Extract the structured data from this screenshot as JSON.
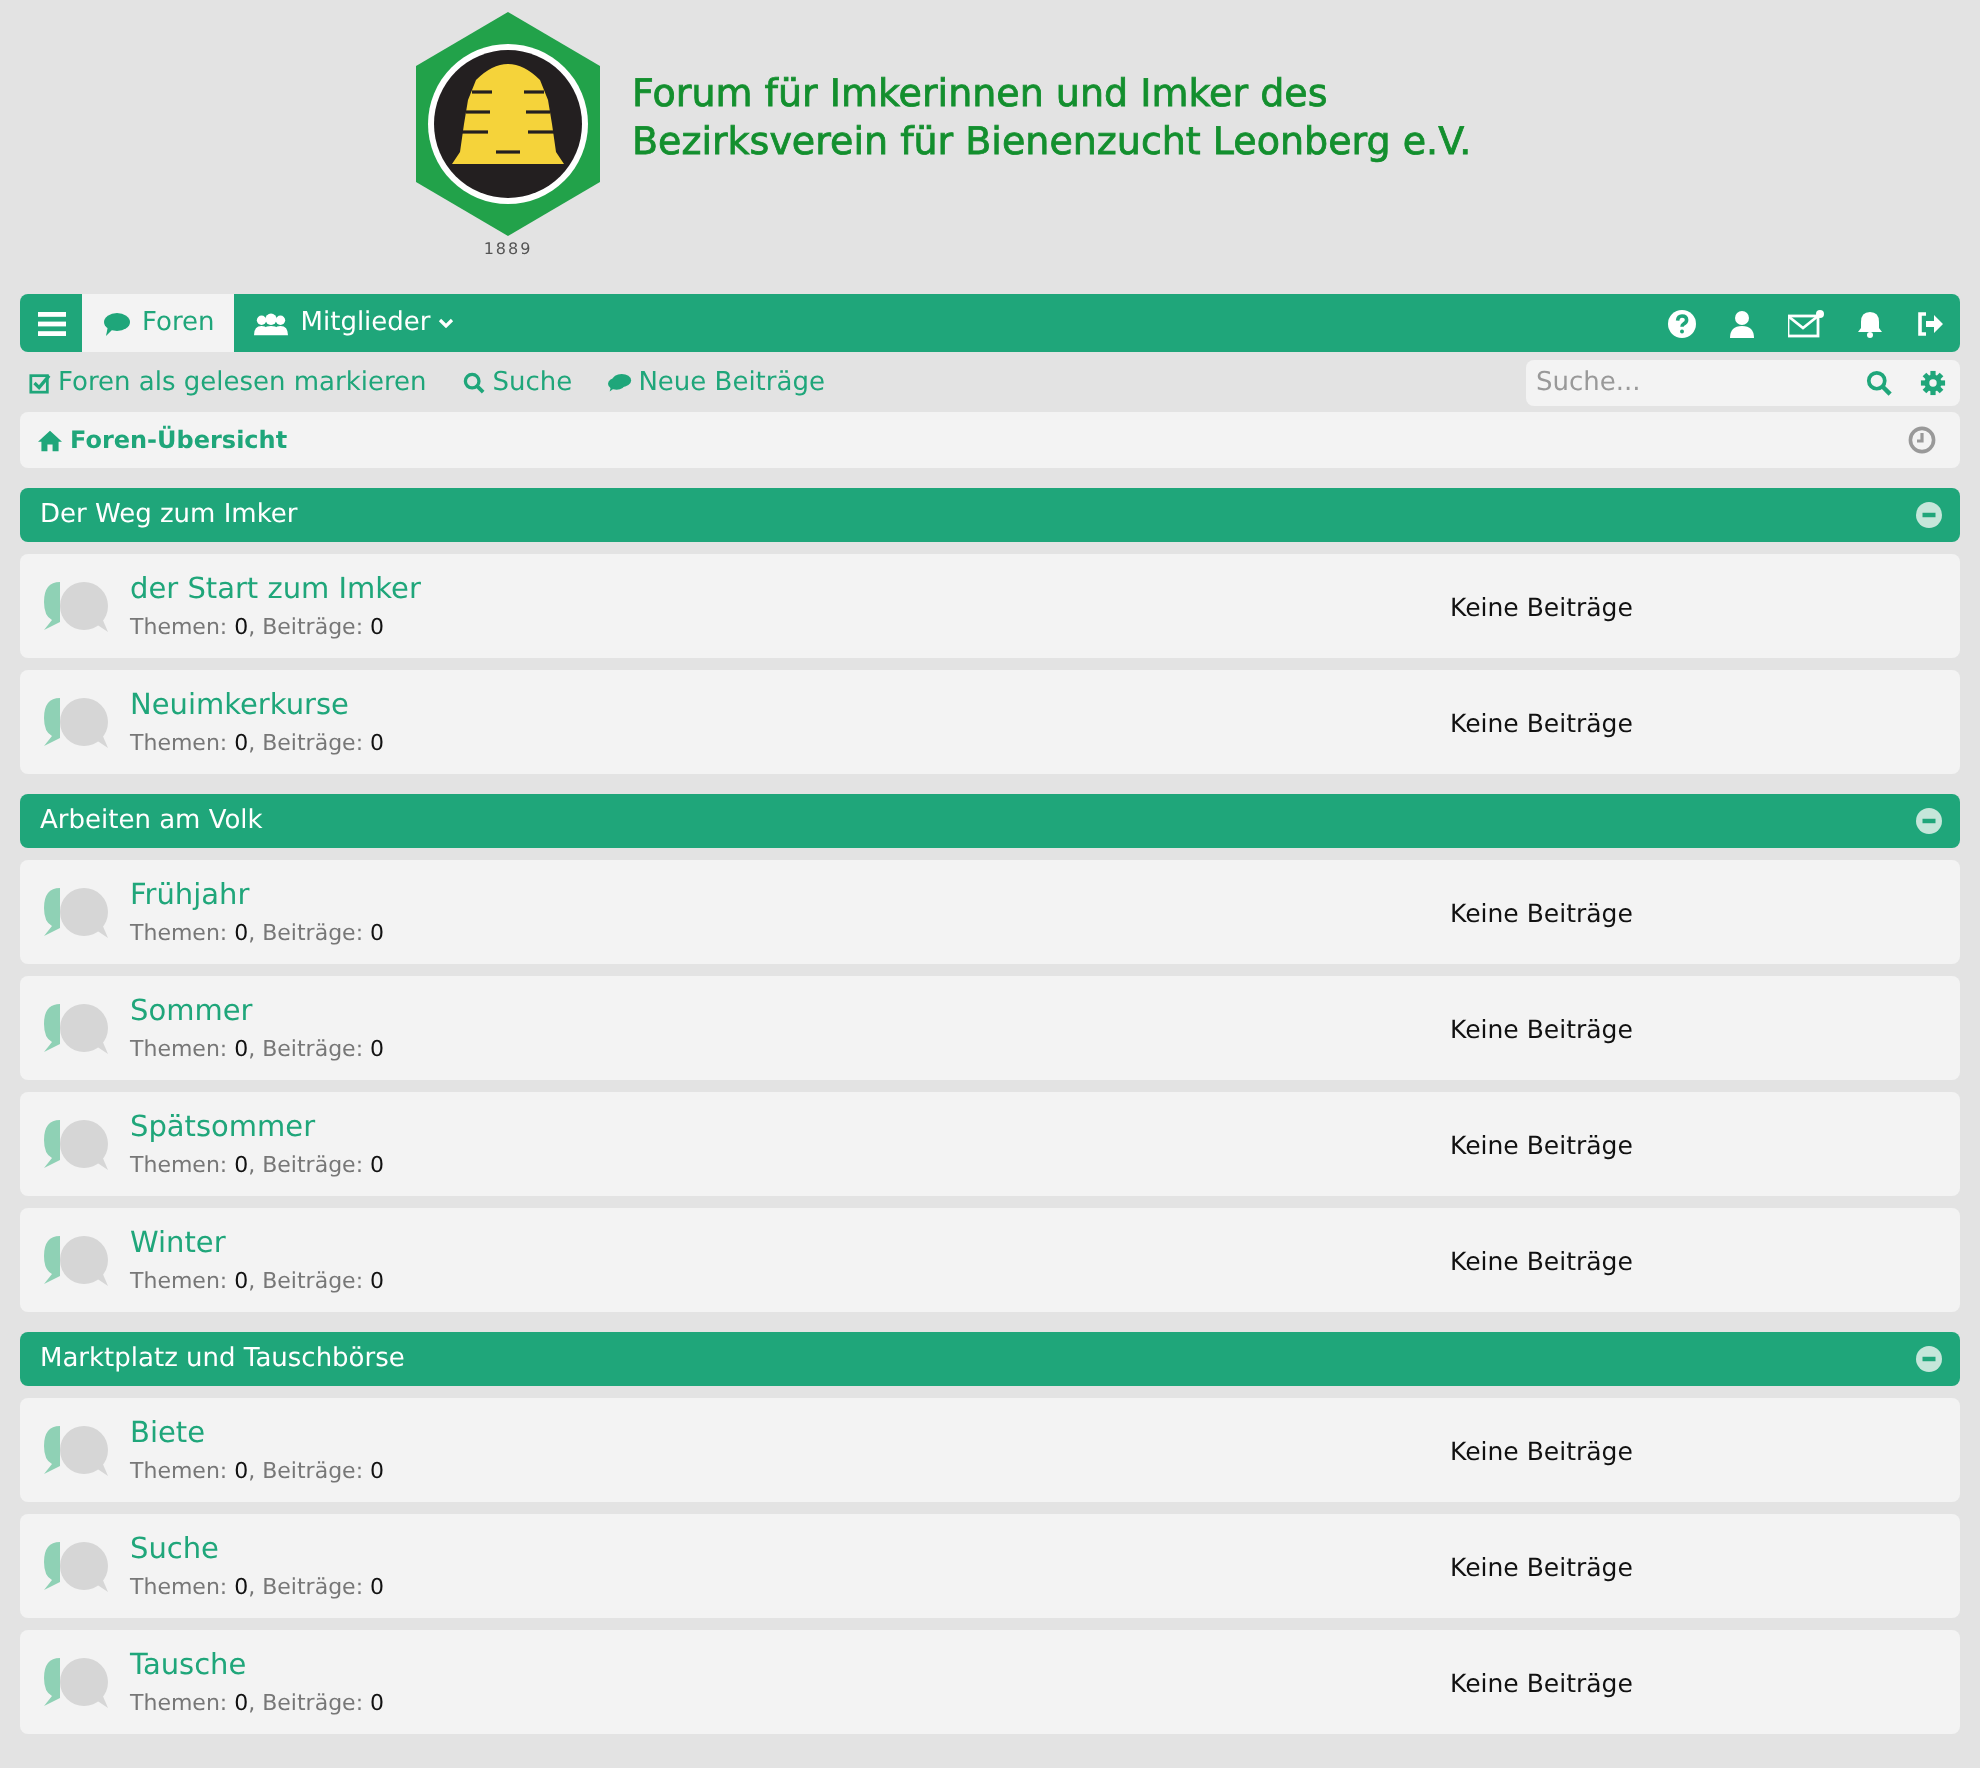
{
  "header": {
    "title_lines": [
      "Forum für Imkerinnen und Imker des",
      "Bezirksverein für Bienenzucht Leonberg e.V."
    ],
    "logo_year": "1889"
  },
  "nav": {
    "tabs": [
      {
        "label": "Foren",
        "selected": true,
        "kind": "forums"
      },
      {
        "label": "Mitglieder",
        "selected": false,
        "kind": "members"
      }
    ]
  },
  "toolbar": {
    "links": [
      {
        "label": "Foren als gelesen markieren",
        "kind": "check"
      },
      {
        "label": "Suche",
        "kind": "search"
      },
      {
        "label": "Neue Beiträge",
        "kind": "comments"
      }
    ],
    "search": {
      "placeholder": "Suche..."
    }
  },
  "breadcrumb": {
    "label": "Foren-Übersicht"
  },
  "categories": [
    {
      "title": "Der Weg zum Imker",
      "expanded": true,
      "forums": [
        {
          "title": "der Start zum Imker",
          "stats": "Themen: **0**, Beiträge: **0**",
          "last_post": "Keine Beiträge"
        },
        {
          "title": "Neuimkerkurse",
          "stats": "Themen: **0**, Beiträge: **0**",
          "last_post": "Keine Beiträge"
        }
      ]
    },
    {
      "title": "Arbeiten am Volk",
      "expanded": true,
      "forums": [
        {
          "title": "Frühjahr",
          "stats": "Themen: **0**, Beiträge: **0**",
          "last_post": "Keine Beiträge"
        },
        {
          "title": "Sommer",
          "stats": "Themen: **0**, Beiträge: **0**",
          "last_post": "Keine Beiträge"
        },
        {
          "title": "Spätsommer",
          "stats": "Themen: **0**, Beiträge: **0**",
          "last_post": "Keine Beiträge"
        },
        {
          "title": "Winter",
          "stats": "Themen: **0**, Beiträge: **0**",
          "last_post": "Keine Beiträge"
        }
      ]
    },
    {
      "title": "Marktplatz und Tauschbörse",
      "expanded": true,
      "forums": [
        {
          "title": "Biete",
          "stats": "Themen: **0**, Beiträge: **0**",
          "last_post": "Keine Beiträge"
        },
        {
          "title": "Suche",
          "stats": "Themen: **0**, Beiträge: **0**",
          "last_post": "Keine Beiträge"
        },
        {
          "title": "Tausche",
          "stats": "Themen: **0**, Beiträge: **0**",
          "last_post": "Keine Beiträge"
        }
      ]
    }
  ]
}
